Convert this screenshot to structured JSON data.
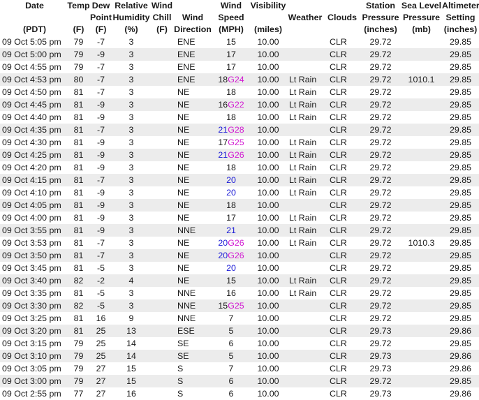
{
  "headers": {
    "date": [
      "Date",
      "",
      "(PDT)"
    ],
    "temp": [
      "Temp",
      "",
      "(F)"
    ],
    "dew": [
      "Dew",
      "Point",
      "(F)"
    ],
    "humidity": [
      "Relative",
      "Humidity",
      "(%)"
    ],
    "chill": [
      "Wind",
      "Chill",
      "(F)"
    ],
    "direction": [
      "",
      "Wind",
      "Direction"
    ],
    "speed": [
      "Wind",
      "Speed",
      "(MPH)"
    ],
    "visibility": [
      "Visibility",
      "",
      "(miles)"
    ],
    "weather": [
      "",
      "Weather",
      ""
    ],
    "clouds": [
      "",
      "Clouds",
      ""
    ],
    "station": [
      "Station",
      "Pressure",
      "(inches)"
    ],
    "sealevel": [
      "Sea Level",
      "Pressure",
      "(mb)"
    ],
    "altimeter": [
      "Altimeter",
      "Setting",
      "(inches)"
    ]
  },
  "colors": {
    "speed_highlight": "#1a1ad6",
    "gust": "#d21ad2",
    "row_alt": "#ececec"
  },
  "rows": [
    {
      "date": "09 Oct 5:05 pm",
      "temp": "79",
      "dew": "-7",
      "hum": "3",
      "chill": "",
      "dir": "ENE",
      "speed": "15",
      "gust": "",
      "hl": false,
      "vis": "10.00",
      "wx": "",
      "clouds": "CLR",
      "stn": "29.72",
      "slp": "",
      "alt": "29.85"
    },
    {
      "date": "09 Oct 5:00 pm",
      "temp": "79",
      "dew": "-9",
      "hum": "3",
      "chill": "",
      "dir": "ENE",
      "speed": "17",
      "gust": "",
      "hl": false,
      "vis": "10.00",
      "wx": "",
      "clouds": "CLR",
      "stn": "29.72",
      "slp": "",
      "alt": "29.85"
    },
    {
      "date": "09 Oct 4:55 pm",
      "temp": "79",
      "dew": "-7",
      "hum": "3",
      "chill": "",
      "dir": "ENE",
      "speed": "17",
      "gust": "",
      "hl": false,
      "vis": "10.00",
      "wx": "",
      "clouds": "CLR",
      "stn": "29.72",
      "slp": "",
      "alt": "29.85"
    },
    {
      "date": "09 Oct 4:53 pm",
      "temp": "80",
      "dew": "-7",
      "hum": "3",
      "chill": "",
      "dir": "ENE",
      "speed": "18",
      "gust": "G24",
      "hl": false,
      "vis": "10.00",
      "wx": "Lt Rain",
      "clouds": "CLR",
      "stn": "29.72",
      "slp": "1010.1",
      "alt": "29.85"
    },
    {
      "date": "09 Oct 4:50 pm",
      "temp": "81",
      "dew": "-7",
      "hum": "3",
      "chill": "",
      "dir": "NE",
      "speed": "18",
      "gust": "",
      "hl": false,
      "vis": "10.00",
      "wx": "Lt Rain",
      "clouds": "CLR",
      "stn": "29.72",
      "slp": "",
      "alt": "29.85"
    },
    {
      "date": "09 Oct 4:45 pm",
      "temp": "81",
      "dew": "-9",
      "hum": "3",
      "chill": "",
      "dir": "NE",
      "speed": "16",
      "gust": "G22",
      "hl": false,
      "vis": "10.00",
      "wx": "Lt Rain",
      "clouds": "CLR",
      "stn": "29.72",
      "slp": "",
      "alt": "29.85"
    },
    {
      "date": "09 Oct 4:40 pm",
      "temp": "81",
      "dew": "-9",
      "hum": "3",
      "chill": "",
      "dir": "NE",
      "speed": "18",
      "gust": "",
      "hl": false,
      "vis": "10.00",
      "wx": "Lt Rain",
      "clouds": "CLR",
      "stn": "29.72",
      "slp": "",
      "alt": "29.85"
    },
    {
      "date": "09 Oct 4:35 pm",
      "temp": "81",
      "dew": "-7",
      "hum": "3",
      "chill": "",
      "dir": "NE",
      "speed": "21",
      "gust": "G28",
      "hl": true,
      "vis": "10.00",
      "wx": "",
      "clouds": "CLR",
      "stn": "29.72",
      "slp": "",
      "alt": "29.85"
    },
    {
      "date": "09 Oct 4:30 pm",
      "temp": "81",
      "dew": "-9",
      "hum": "3",
      "chill": "",
      "dir": "NE",
      "speed": "17",
      "gust": "G25",
      "hl": false,
      "vis": "10.00",
      "wx": "Lt Rain",
      "clouds": "CLR",
      "stn": "29.72",
      "slp": "",
      "alt": "29.85"
    },
    {
      "date": "09 Oct 4:25 pm",
      "temp": "81",
      "dew": "-9",
      "hum": "3",
      "chill": "",
      "dir": "NE",
      "speed": "21",
      "gust": "G26",
      "hl": true,
      "vis": "10.00",
      "wx": "Lt Rain",
      "clouds": "CLR",
      "stn": "29.72",
      "slp": "",
      "alt": "29.85"
    },
    {
      "date": "09 Oct 4:20 pm",
      "temp": "81",
      "dew": "-9",
      "hum": "3",
      "chill": "",
      "dir": "NE",
      "speed": "18",
      "gust": "",
      "hl": false,
      "vis": "10.00",
      "wx": "Lt Rain",
      "clouds": "CLR",
      "stn": "29.72",
      "slp": "",
      "alt": "29.85"
    },
    {
      "date": "09 Oct 4:15 pm",
      "temp": "81",
      "dew": "-7",
      "hum": "3",
      "chill": "",
      "dir": "NE",
      "speed": "20",
      "gust": "",
      "hl": true,
      "vis": "10.00",
      "wx": "Lt Rain",
      "clouds": "CLR",
      "stn": "29.72",
      "slp": "",
      "alt": "29.85"
    },
    {
      "date": "09 Oct 4:10 pm",
      "temp": "81",
      "dew": "-9",
      "hum": "3",
      "chill": "",
      "dir": "NE",
      "speed": "20",
      "gust": "",
      "hl": true,
      "vis": "10.00",
      "wx": "Lt Rain",
      "clouds": "CLR",
      "stn": "29.72",
      "slp": "",
      "alt": "29.85"
    },
    {
      "date": "09 Oct 4:05 pm",
      "temp": "81",
      "dew": "-9",
      "hum": "3",
      "chill": "",
      "dir": "NE",
      "speed": "18",
      "gust": "",
      "hl": false,
      "vis": "10.00",
      "wx": "",
      "clouds": "CLR",
      "stn": "29.72",
      "slp": "",
      "alt": "29.85"
    },
    {
      "date": "09 Oct 4:00 pm",
      "temp": "81",
      "dew": "-9",
      "hum": "3",
      "chill": "",
      "dir": "NE",
      "speed": "17",
      "gust": "",
      "hl": false,
      "vis": "10.00",
      "wx": "Lt Rain",
      "clouds": "CLR",
      "stn": "29.72",
      "slp": "",
      "alt": "29.85"
    },
    {
      "date": "09 Oct 3:55 pm",
      "temp": "81",
      "dew": "-9",
      "hum": "3",
      "chill": "",
      "dir": "NNE",
      "speed": "21",
      "gust": "",
      "hl": true,
      "vis": "10.00",
      "wx": "Lt Rain",
      "clouds": "CLR",
      "stn": "29.72",
      "slp": "",
      "alt": "29.85"
    },
    {
      "date": "09 Oct 3:53 pm",
      "temp": "81",
      "dew": "-7",
      "hum": "3",
      "chill": "",
      "dir": "NE",
      "speed": "20",
      "gust": "G26",
      "hl": true,
      "vis": "10.00",
      "wx": "Lt Rain",
      "clouds": "CLR",
      "stn": "29.72",
      "slp": "1010.3",
      "alt": "29.85"
    },
    {
      "date": "09 Oct 3:50 pm",
      "temp": "81",
      "dew": "-7",
      "hum": "3",
      "chill": "",
      "dir": "NE",
      "speed": "20",
      "gust": "G26",
      "hl": true,
      "vis": "10.00",
      "wx": "",
      "clouds": "CLR",
      "stn": "29.72",
      "slp": "",
      "alt": "29.85"
    },
    {
      "date": "09 Oct 3:45 pm",
      "temp": "81",
      "dew": "-5",
      "hum": "3",
      "chill": "",
      "dir": "NE",
      "speed": "20",
      "gust": "",
      "hl": true,
      "vis": "10.00",
      "wx": "",
      "clouds": "CLR",
      "stn": "29.72",
      "slp": "",
      "alt": "29.85"
    },
    {
      "date": "09 Oct 3:40 pm",
      "temp": "82",
      "dew": "-2",
      "hum": "4",
      "chill": "",
      "dir": "NE",
      "speed": "15",
      "gust": "",
      "hl": false,
      "vis": "10.00",
      "wx": "Lt Rain",
      "clouds": "CLR",
      "stn": "29.72",
      "slp": "",
      "alt": "29.85"
    },
    {
      "date": "09 Oct 3:35 pm",
      "temp": "81",
      "dew": "-5",
      "hum": "3",
      "chill": "",
      "dir": "NNE",
      "speed": "16",
      "gust": "",
      "hl": false,
      "vis": "10.00",
      "wx": "Lt Rain",
      "clouds": "CLR",
      "stn": "29.72",
      "slp": "",
      "alt": "29.85"
    },
    {
      "date": "09 Oct 3:30 pm",
      "temp": "82",
      "dew": "-5",
      "hum": "3",
      "chill": "",
      "dir": "NNE",
      "speed": "15",
      "gust": "G25",
      "hl": false,
      "vis": "10.00",
      "wx": "",
      "clouds": "CLR",
      "stn": "29.72",
      "slp": "",
      "alt": "29.85"
    },
    {
      "date": "09 Oct 3:25 pm",
      "temp": "81",
      "dew": "16",
      "hum": "9",
      "chill": "",
      "dir": "NNE",
      "speed": "7",
      "gust": "",
      "hl": false,
      "vis": "10.00",
      "wx": "",
      "clouds": "CLR",
      "stn": "29.72",
      "slp": "",
      "alt": "29.85"
    },
    {
      "date": "09 Oct 3:20 pm",
      "temp": "81",
      "dew": "25",
      "hum": "13",
      "chill": "",
      "dir": "ESE",
      "speed": "5",
      "gust": "",
      "hl": false,
      "vis": "10.00",
      "wx": "",
      "clouds": "CLR",
      "stn": "29.73",
      "slp": "",
      "alt": "29.86"
    },
    {
      "date": "09 Oct 3:15 pm",
      "temp": "79",
      "dew": "25",
      "hum": "14",
      "chill": "",
      "dir": "SE",
      "speed": "6",
      "gust": "",
      "hl": false,
      "vis": "10.00",
      "wx": "",
      "clouds": "CLR",
      "stn": "29.72",
      "slp": "",
      "alt": "29.85"
    },
    {
      "date": "09 Oct 3:10 pm",
      "temp": "79",
      "dew": "25",
      "hum": "14",
      "chill": "",
      "dir": "SE",
      "speed": "5",
      "gust": "",
      "hl": false,
      "vis": "10.00",
      "wx": "",
      "clouds": "CLR",
      "stn": "29.73",
      "slp": "",
      "alt": "29.86"
    },
    {
      "date": "09 Oct 3:05 pm",
      "temp": "79",
      "dew": "27",
      "hum": "15",
      "chill": "",
      "dir": "S",
      "speed": "7",
      "gust": "",
      "hl": false,
      "vis": "10.00",
      "wx": "",
      "clouds": "CLR",
      "stn": "29.73",
      "slp": "",
      "alt": "29.86"
    },
    {
      "date": "09 Oct 3:00 pm",
      "temp": "79",
      "dew": "27",
      "hum": "15",
      "chill": "",
      "dir": "S",
      "speed": "6",
      "gust": "",
      "hl": false,
      "vis": "10.00",
      "wx": "",
      "clouds": "CLR",
      "stn": "29.72",
      "slp": "",
      "alt": "29.85"
    },
    {
      "date": "09 Oct 2:55 pm",
      "temp": "77",
      "dew": "27",
      "hum": "16",
      "chill": "",
      "dir": "S",
      "speed": "6",
      "gust": "",
      "hl": false,
      "vis": "10.00",
      "wx": "",
      "clouds": "CLR",
      "stn": "29.73",
      "slp": "",
      "alt": "29.86"
    }
  ]
}
